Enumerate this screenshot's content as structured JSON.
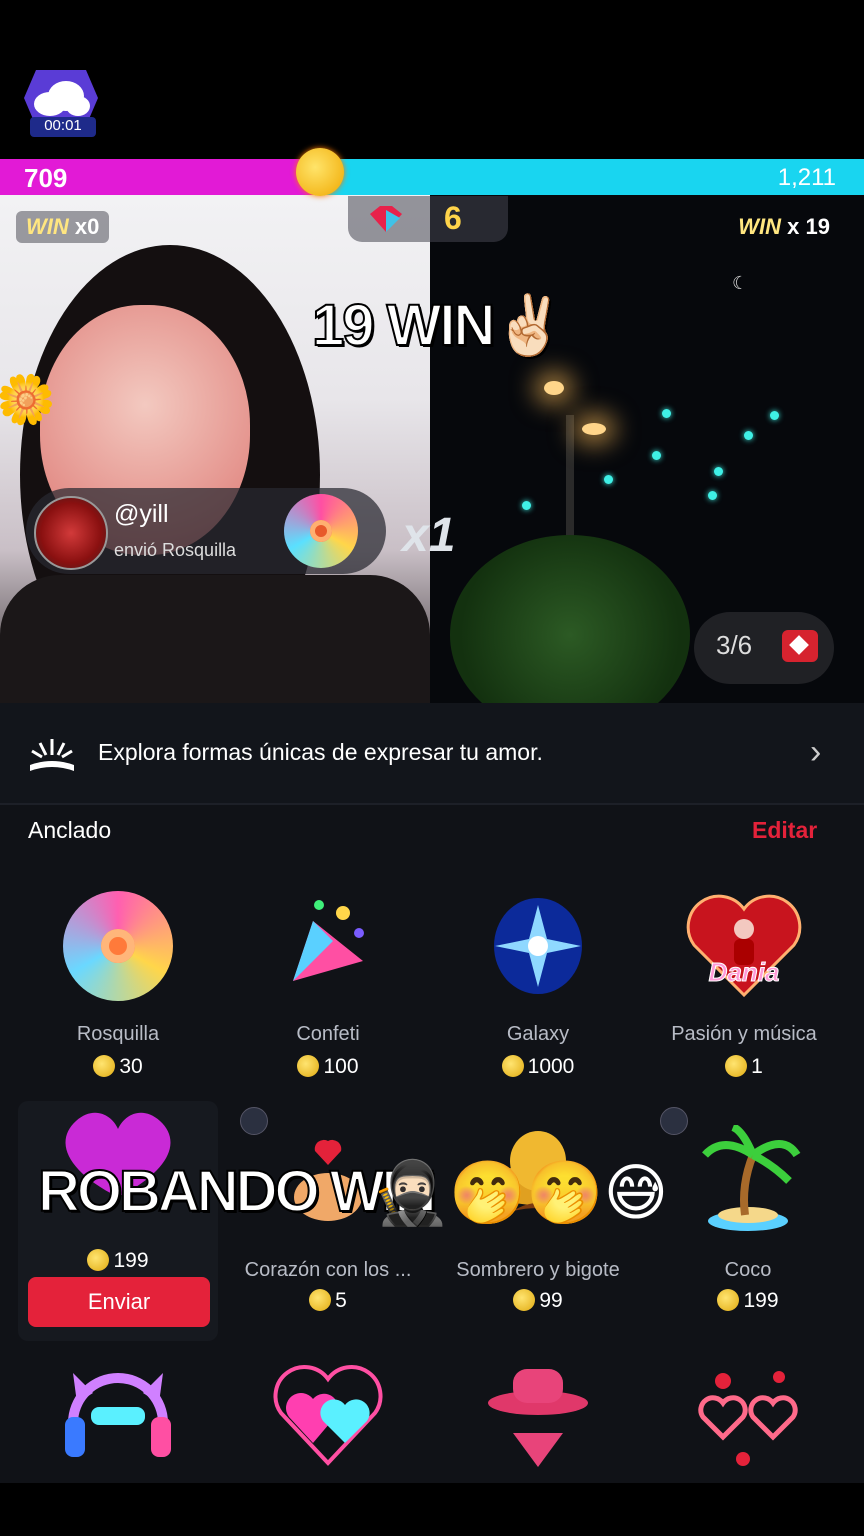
{
  "battle": {
    "timer": "00:01",
    "score_left": "709",
    "score_right": "1,211",
    "score_left_value": 709,
    "score_right_value": 1211,
    "win_left_word": "WIN",
    "win_left_count": "x0",
    "win_right_word": "WIN",
    "win_right_count": "x 19",
    "gem_count": "6",
    "overlay_win": "19 WIN✌🏻",
    "round": "3/6"
  },
  "gift_notice": {
    "user": "@yill",
    "action": "envió Rosquilla",
    "multiplier": "x1"
  },
  "panel": {
    "promo_text": "Explora formas únicas de expresar tu amor.",
    "promo_chevron": "›",
    "section_title": "Anclado",
    "edit_label": "Editar",
    "send_label": "Enviar",
    "gifts_row1": [
      {
        "name": "Rosquilla",
        "price": "30",
        "icon": "donut-icon"
      },
      {
        "name": "Confeti",
        "price": "100",
        "icon": "confetti-icon"
      },
      {
        "name": "Galaxy",
        "price": "1000",
        "icon": "galaxy-icon"
      },
      {
        "name": "Pasión y música",
        "price": "1",
        "icon": "passion-music-icon"
      }
    ],
    "gifts_row2": [
      {
        "name": "",
        "price": "199",
        "icon": "heart-blob-icon"
      },
      {
        "name": "Corazón con los ...",
        "price": "5",
        "icon": "heart-hands-icon"
      },
      {
        "name": "Sombrero y bigote",
        "price": "99",
        "icon": "hat-mustache-icon"
      },
      {
        "name": "Coco",
        "price": "199",
        "icon": "palm-tree-icon"
      }
    ],
    "dania_label": "Dania"
  },
  "overlay": {
    "text": "ROBANDO WIN",
    "emojis": "🥷🏻🤭🤭😅"
  },
  "colors": {
    "left_team": "#e21ad6",
    "right_team": "#19d5f0",
    "accent_red": "#e4223a",
    "panel_bg": "#101217"
  }
}
